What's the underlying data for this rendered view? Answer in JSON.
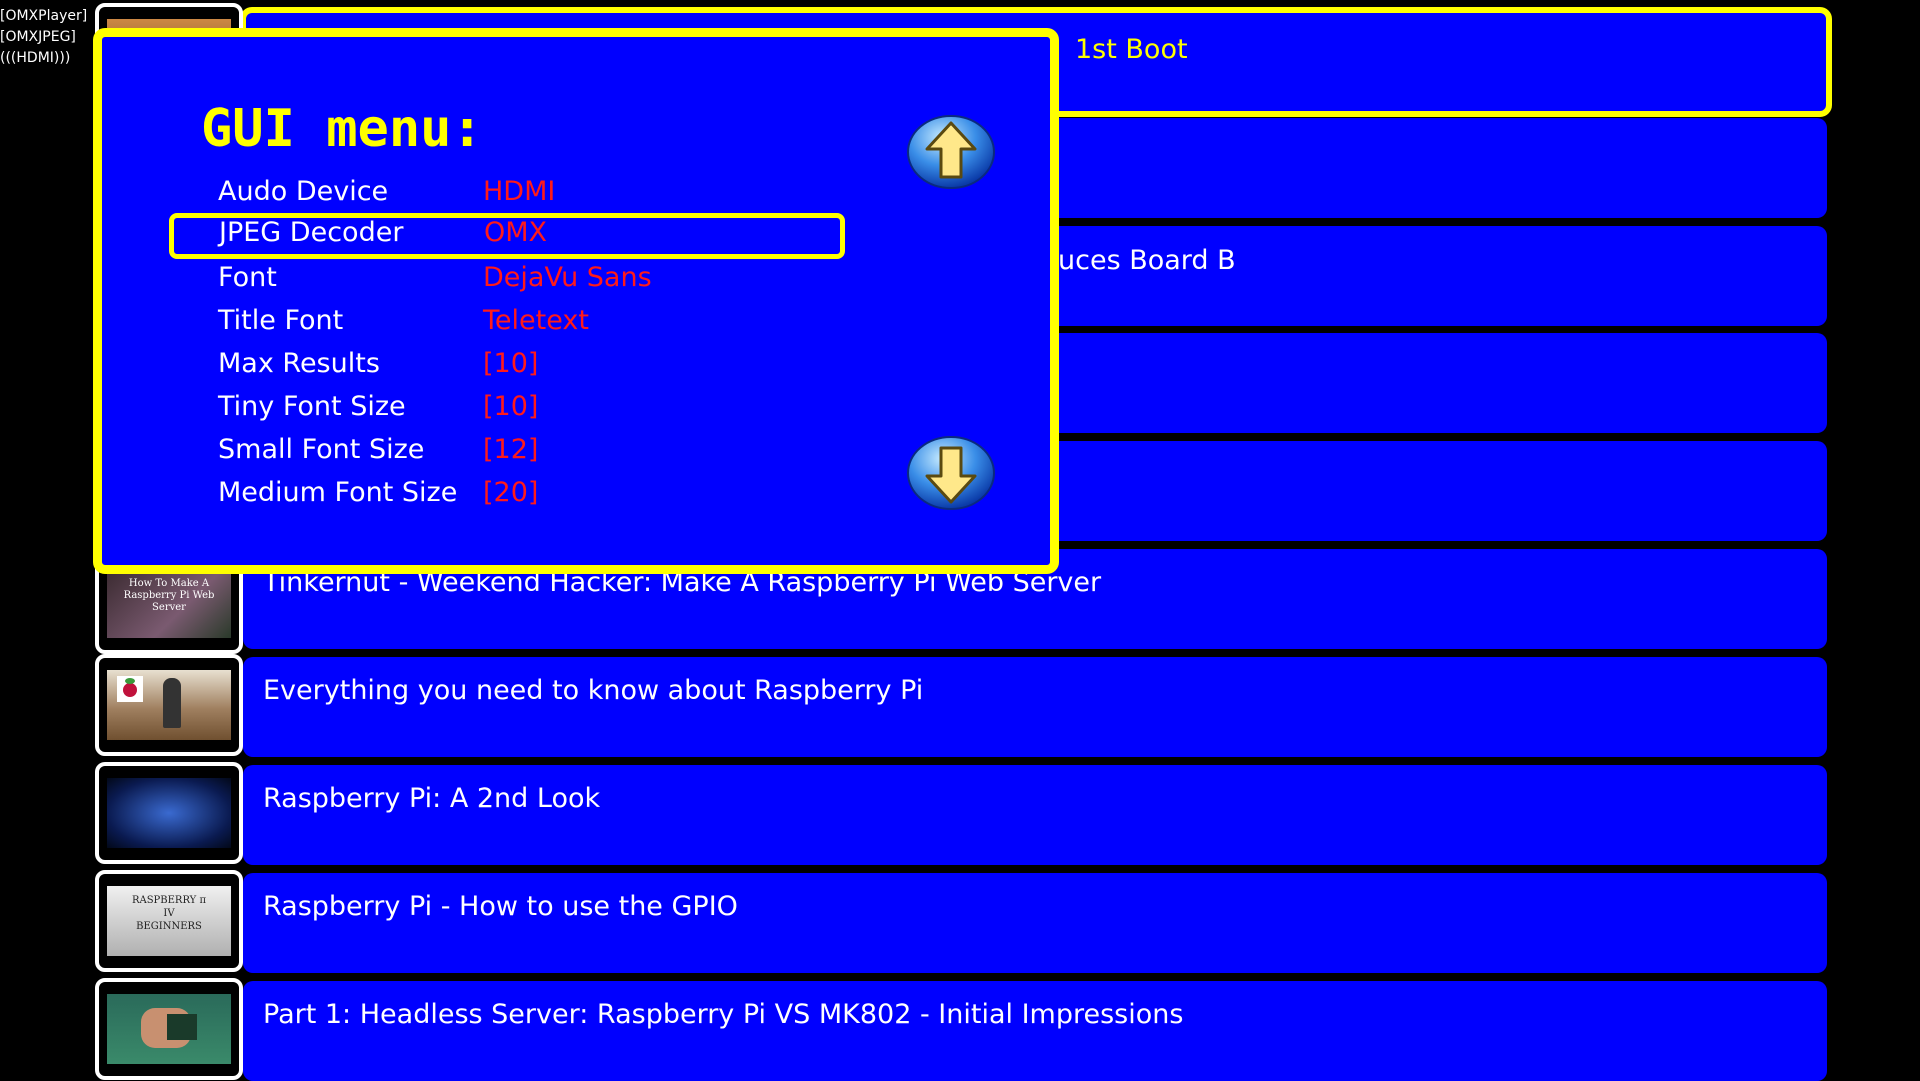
{
  "status": {
    "player": "[OMXPlayer]",
    "jpeg": "[OMXJPEG]",
    "audio": "(((HDMI)))"
  },
  "results": [
    {
      "title": "1st Boot",
      "selected": true
    },
    {
      "title": ""
    },
    {
      "title": "uces Board B"
    },
    {
      "title": ""
    },
    {
      "title": ""
    },
    {
      "title": "Tinkernut - Weekend Hacker: Make A Raspberry Pi Web Server",
      "thumb_caption": "How To Make A Raspberry Pi Web Server"
    },
    {
      "title": "Everything you need to know about Raspberry Pi"
    },
    {
      "title": "Raspberry Pi: A 2nd Look"
    },
    {
      "title": "Raspberry Pi - How to use the GPIO",
      "thumb_caption": "RASPBERRY π IV BEGINNERS"
    },
    {
      "title": "Part 1: Headless Server: Raspberry Pi VS MK802 - Initial Impressions"
    }
  ],
  "gui_menu": {
    "title": "GUI menu:",
    "options": [
      {
        "label": "Audo Device",
        "value": "HDMI"
      },
      {
        "label": "JPEG Decoder",
        "value": "OMX",
        "selected": true
      },
      {
        "label": "Font",
        "value": "DejaVu Sans"
      },
      {
        "label": "Title Font",
        "value": "Teletext"
      },
      {
        "label": "Max Results",
        "value": "[10]"
      },
      {
        "label": "Tiny Font Size",
        "value": "[10]"
      },
      {
        "label": "Small Font Size",
        "value": "[12]"
      },
      {
        "label": "Medium Font Size",
        "value": "[20]"
      }
    ],
    "scroll_up_icon": "up-arrow-icon",
    "scroll_down_icon": "down-arrow-icon"
  },
  "colors": {
    "background": "#000000",
    "panel": "#0000ff",
    "highlight": "#ffff00",
    "value_text": "#ff1a1a",
    "text": "#ffffff"
  }
}
